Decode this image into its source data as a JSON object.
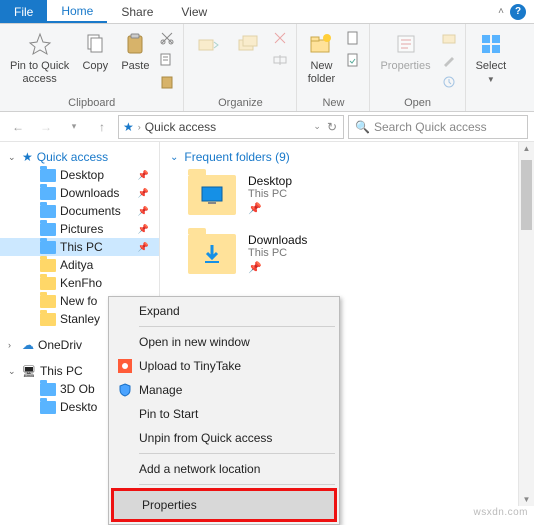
{
  "menubar": {
    "file": "File",
    "tabs": [
      "Home",
      "Share",
      "View"
    ],
    "active_tab": 0
  },
  "ribbon": {
    "groups": [
      {
        "label": "Clipboard",
        "items": [
          {
            "name": "pin-to-quick-access",
            "label": "Pin to Quick\naccess",
            "icon": "pin"
          },
          {
            "name": "copy",
            "label": "Copy",
            "icon": "copy"
          },
          {
            "name": "paste",
            "label": "Paste",
            "icon": "paste"
          }
        ],
        "small": [
          "cut",
          "copy-path",
          "paste-shortcut"
        ]
      },
      {
        "label": "Organize",
        "items": [
          {
            "name": "move-to",
            "label": "",
            "icon": "moveto",
            "dimmed": true
          },
          {
            "name": "copy-to",
            "label": "",
            "icon": "copyto",
            "dimmed": true
          },
          {
            "name": "delete",
            "label": "",
            "icon": "delete",
            "dimmed": true
          },
          {
            "name": "rename",
            "label": "",
            "icon": "rename",
            "dimmed": true
          }
        ]
      },
      {
        "label": "New",
        "items": [
          {
            "name": "new-folder",
            "label": "New\nfolder",
            "icon": "newfolder"
          }
        ]
      },
      {
        "label": "Open",
        "items": [
          {
            "name": "properties",
            "label": "Properties",
            "icon": "properties",
            "dimmed": true
          }
        ]
      },
      {
        "label": "",
        "items": [
          {
            "name": "select",
            "label": "Select",
            "icon": "select"
          }
        ]
      }
    ]
  },
  "address": {
    "star": "★",
    "crumb": "Quick access",
    "search_placeholder": "Search Quick access"
  },
  "nav": {
    "items": [
      {
        "name": "quick-access-root",
        "label": "Quick access",
        "expander": "v",
        "icon": "star",
        "class": "qa-head",
        "pin": false
      },
      {
        "name": "desktop",
        "label": "Desktop",
        "indent": 1,
        "icon": "blue",
        "pin": true
      },
      {
        "name": "downloads",
        "label": "Downloads",
        "indent": 1,
        "icon": "blue",
        "pin": true
      },
      {
        "name": "documents",
        "label": "Documents",
        "indent": 1,
        "icon": "blue",
        "pin": true
      },
      {
        "name": "pictures",
        "label": "Pictures",
        "indent": 1,
        "icon": "blue",
        "pin": true
      },
      {
        "name": "this-pc-qa",
        "label": "This PC",
        "indent": 1,
        "icon": "blue",
        "pin": true,
        "selected": true
      },
      {
        "name": "aditya",
        "label": "Aditya",
        "indent": 1,
        "icon": "yellow",
        "pin": false,
        "truncated": true
      },
      {
        "name": "kenfho",
        "label": "KenFho",
        "indent": 1,
        "icon": "yellow",
        "pin": false,
        "truncated": true
      },
      {
        "name": "new-fo",
        "label": "New fo",
        "indent": 1,
        "icon": "yellow",
        "pin": false,
        "truncated": true
      },
      {
        "name": "stanley",
        "label": "Stanley",
        "indent": 1,
        "icon": "yellow",
        "pin": false,
        "truncated": true
      },
      {
        "name": "onedrive",
        "label": "OneDriv",
        "expander": ">",
        "icon": "cloud",
        "pin": false,
        "truncated": true
      },
      {
        "name": "this-pc",
        "label": "This PC",
        "expander": "v",
        "icon": "pc",
        "pin": false
      },
      {
        "name": "3d-objects",
        "label": "3D Ob",
        "indent": 1,
        "icon": "blue",
        "pin": false,
        "truncated": true
      },
      {
        "name": "desktop2",
        "label": "Deskto",
        "indent": 1,
        "icon": "blue",
        "pin": false,
        "truncated": true
      }
    ]
  },
  "content": {
    "heading": "Frequent folders (9)",
    "items": [
      {
        "name": "Desktop",
        "location": "This PC",
        "thumb": "desktop"
      },
      {
        "name": "Downloads",
        "location": "This PC",
        "thumb": "downloads"
      }
    ]
  },
  "context_menu": {
    "items": [
      {
        "name": "expand",
        "label": "Expand"
      },
      {
        "sep": true
      },
      {
        "name": "open-new-window",
        "label": "Open in new window"
      },
      {
        "name": "upload-tinytake",
        "label": "Upload to TinyTake",
        "icon": "tinytake"
      },
      {
        "name": "manage",
        "label": "Manage",
        "icon": "shield"
      },
      {
        "name": "pin-to-start",
        "label": "Pin to Start"
      },
      {
        "name": "unpin-qa",
        "label": "Unpin from Quick access"
      },
      {
        "sep": true
      },
      {
        "name": "add-network",
        "label": "Add a network location"
      },
      {
        "sep": true
      },
      {
        "name": "properties",
        "label": "Properties",
        "highlight": true
      }
    ]
  },
  "watermark": "wsxdn.com"
}
